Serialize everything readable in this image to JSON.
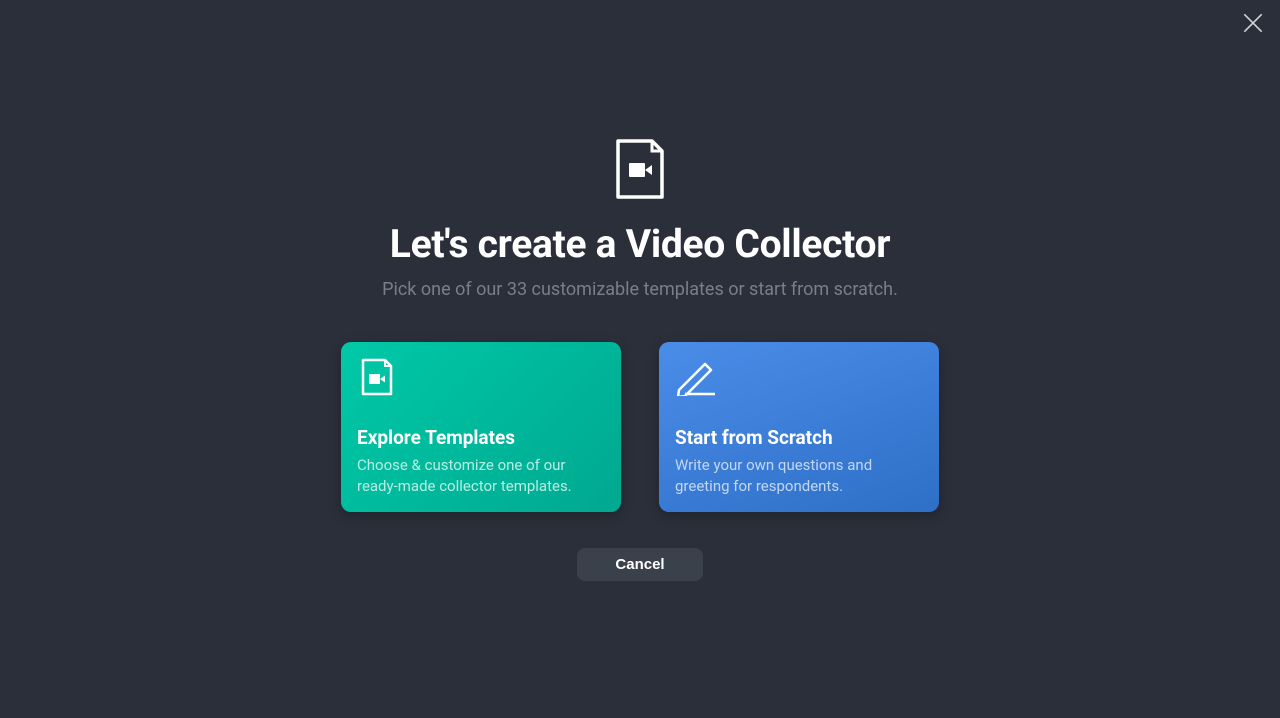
{
  "heading": "Let's create a Video Collector",
  "subheading": "Pick one of our 33 customizable templates or start from scratch.",
  "cards": {
    "templates": {
      "title": "Explore Templates",
      "description": "Choose & customize one of our ready-made collector templates."
    },
    "scratch": {
      "title": "Start from Scratch",
      "description": "Write your own questions and greeting for respondents."
    }
  },
  "cancel_label": "Cancel"
}
